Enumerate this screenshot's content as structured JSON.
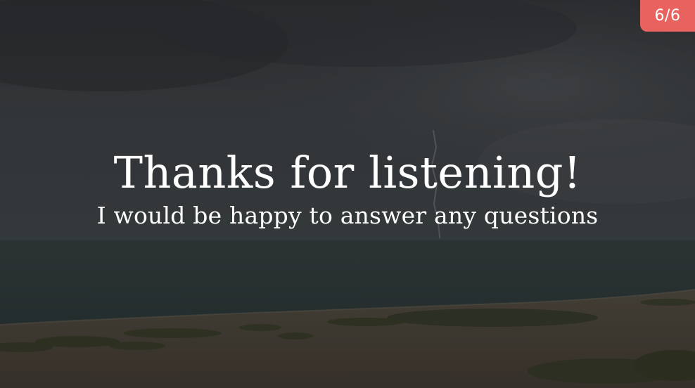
{
  "slide": {
    "counter": "6/6",
    "title": "Thanks for listening!",
    "subtitle": "I would be happy to answer any questions"
  },
  "colors": {
    "counter_bg": "#e8625f",
    "text": "#ffffff",
    "sky": "#34373a",
    "sea": "#2d3536",
    "sand": "#4a4339"
  }
}
